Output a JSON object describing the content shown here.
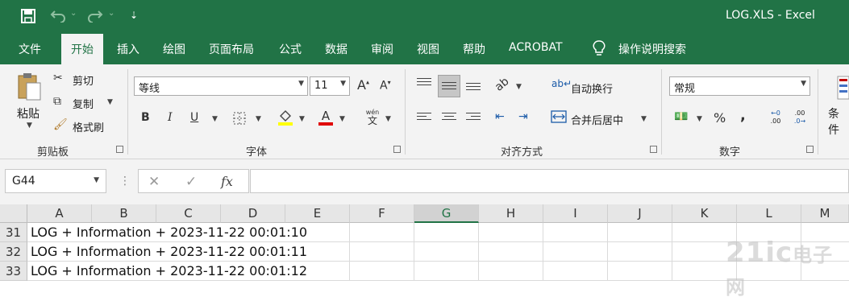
{
  "title_bar": {
    "title": "LOG.XLS  -  Excel"
  },
  "tabs": [
    "文件",
    "开始",
    "插入",
    "绘图",
    "页面布局",
    "公式",
    "数据",
    "审阅",
    "视图",
    "帮助",
    "ACROBAT"
  ],
  "tell_me": "操作说明搜索",
  "clipboard": {
    "paste": "粘贴",
    "cut": "剪切",
    "copy": "复制",
    "format_painter": "格式刷",
    "group": "剪贴板"
  },
  "font": {
    "name": "等线",
    "size": "11",
    "group": "字体",
    "grow": "A",
    "shrink": "A",
    "bold": "B",
    "italic": "I",
    "underline": "U",
    "wen": "wén",
    "wen_char": "文"
  },
  "alignment": {
    "wrap": "自动换行",
    "merge": "合并后居中",
    "group": "对齐方式"
  },
  "number": {
    "format": "常规",
    "percent": "%",
    "comma": ",",
    "group": "数字",
    "inc": ".00",
    "dec": ".0"
  },
  "styles": {
    "cond": "条件"
  },
  "formula_bar": {
    "name_box": "G44",
    "formula": "",
    "fx": "fx"
  },
  "columns": [
    "A",
    "B",
    "C",
    "D",
    "E",
    "F",
    "G",
    "H",
    "I",
    "J",
    "K",
    "L",
    "M"
  ],
  "selected_column": "G",
  "rows": [
    {
      "num": "31",
      "a": "LOG + Information + 2023-11-22 00:01:10"
    },
    {
      "num": "32",
      "a": "LOG + Information + 2023-11-22 00:01:11"
    },
    {
      "num": "33",
      "a": "LOG + Information + 2023-11-22 00:01:12"
    }
  ],
  "watermark": {
    "logo": "21ic",
    "text": "电子网"
  },
  "colors": {
    "excel_green": "#217346",
    "ribbon_bg": "#f3f3f3"
  }
}
